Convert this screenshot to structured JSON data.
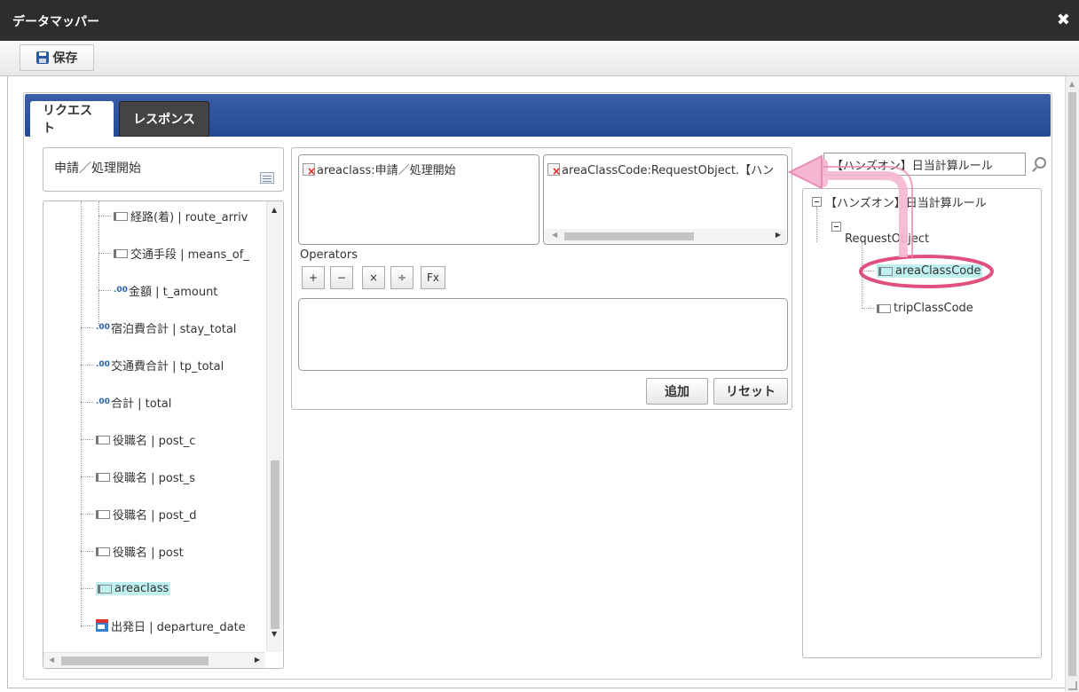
{
  "window": {
    "title": "データマッパー"
  },
  "toolbar": {
    "save_label": "保存"
  },
  "tabs": [
    {
      "label": "リクエスト",
      "active": true
    },
    {
      "label": "レスポンス",
      "active": false
    }
  ],
  "left_panel": {
    "header_label": "申請／処理開始",
    "items": [
      {
        "label": "経路(着) | route_arriv",
        "icon": "field-icon"
      },
      {
        "label": "交通手段 | means_of_",
        "icon": "field-icon"
      },
      {
        "label": "金額 | t_amount",
        "icon": "number-icon"
      },
      {
        "label": "宿泊費合計 | stay_total",
        "icon": "number-icon"
      },
      {
        "label": "交通費合計 | tp_total",
        "icon": "number-icon"
      },
      {
        "label": "合計 | total",
        "icon": "number-icon"
      },
      {
        "label": "役職名 | post_c",
        "icon": "field-icon"
      },
      {
        "label": "役職名 | post_s",
        "icon": "field-icon"
      },
      {
        "label": "役職名 | post_d",
        "icon": "field-icon"
      },
      {
        "label": "役職名 | post",
        "icon": "field-icon"
      },
      {
        "label": "areaclass",
        "icon": "field-icon",
        "highlighted": true
      },
      {
        "label": "出発日 | departure_date",
        "icon": "calendar-icon"
      }
    ],
    "number_icon_text": ".00"
  },
  "center": {
    "source_box": "areaclass:申請／処理開始",
    "target_box": "areaClassCode:RequestObject.【ハン",
    "operators_label": "Operators",
    "operators": [
      "+",
      "−",
      "×",
      "÷",
      "Fx"
    ],
    "add_label": "追加",
    "reset_label": "リセット"
  },
  "right_panel": {
    "search_value": "【ハンズオン】日当計算ルール",
    "root": "【ハンズオン】日当計算ルール",
    "object": "RequestObject",
    "fields": [
      {
        "label": "areaClassCode",
        "highlighted": true
      },
      {
        "label": "tripClassCode",
        "highlighted": false
      }
    ]
  },
  "colors": {
    "titlebar": "#2d2d2d",
    "tabbar": "#2a4f96",
    "highlight": "#bff0f0",
    "annotation": "#e0507f"
  }
}
